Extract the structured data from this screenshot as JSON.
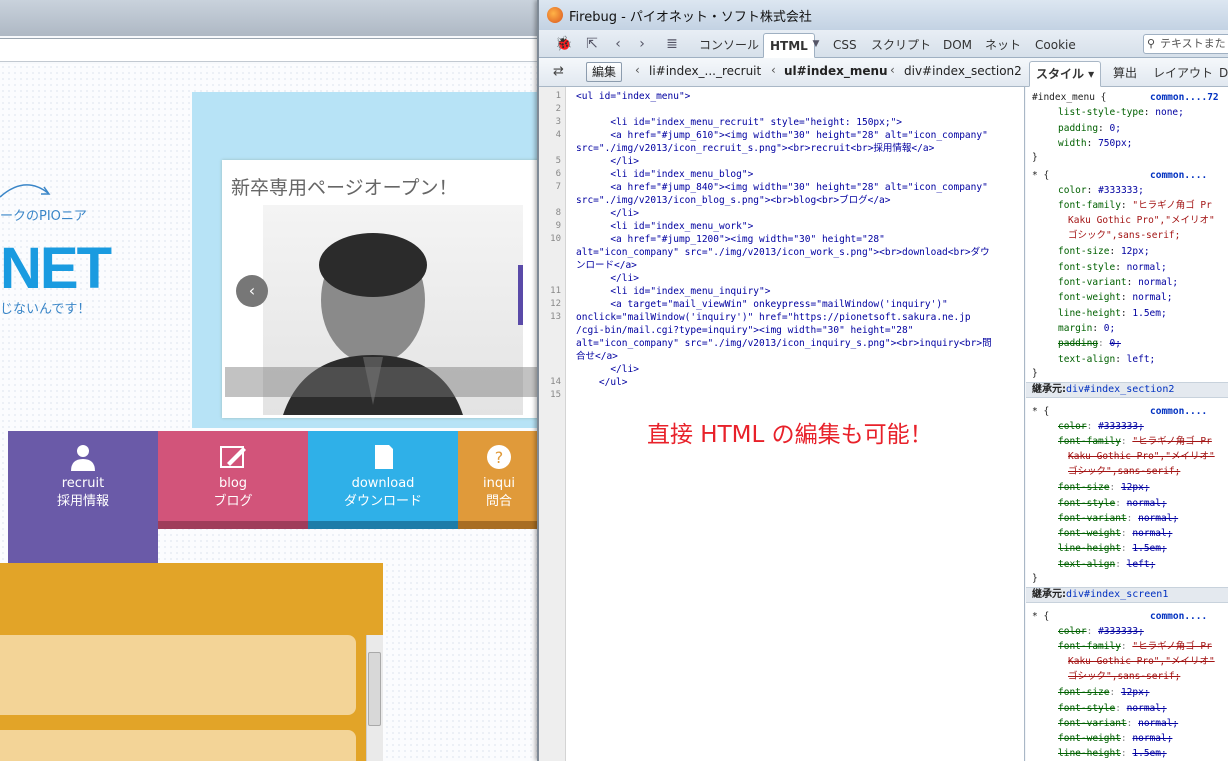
{
  "website": {
    "logo_sub": "ークのPIOニア",
    "logo_main": "NET",
    "logo_tag": "じないんです！",
    "slide_title": "新卒専用ページオープン！",
    "slide_prev_glyph": "‹",
    "nav": [
      {
        "en": "recruit",
        "ja": "採用情報",
        "icon": "people-icon"
      },
      {
        "en": "blog",
        "ja": "ブログ",
        "icon": "pen-icon"
      },
      {
        "en": "download",
        "ja": "ダウンロード",
        "icon": "document-icon"
      },
      {
        "en": "inqui",
        "ja": "問合",
        "icon": "question-icon"
      }
    ]
  },
  "firebug": {
    "title": "Firebug - パイオネット・ソフト株式会社",
    "tabs": [
      "コンソール",
      "HTML",
      "CSS",
      "スクリプト",
      "DOM",
      "ネット",
      "Cookie"
    ],
    "active_tab": "HTML",
    "search_placeholder": "テキストまた",
    "edit_button": "編集",
    "breadcrumbs": [
      "li#index_..._recruit",
      "ul#index_menu",
      "div#index_section2"
    ],
    "side_tabs": [
      "スタイル ▾",
      "算出",
      "レイアウト",
      "D"
    ],
    "annotation": "直接 HTML の編集も可能！",
    "code_lines": [
      "<ul id=\"index_menu\">",
      "",
      "      <li id=\"index_menu_recruit\" style=\"height: 150px;\">",
      "      <a href=\"#jump_610\"><img width=\"30\" height=\"28\" alt=\"icon_company\"",
      "src=\"./img/v2013/icon_recruit_s.png\"><br>recruit<br>採用情報</a>",
      "      </li>",
      "      <li id=\"index_menu_blog\">",
      "      <a href=\"#jump_840\"><img width=\"30\" height=\"28\" alt=\"icon_company\"",
      "src=\"./img/v2013/icon_blog_s.png\"><br>blog<br>ブログ</a>",
      "      </li>",
      "      <li id=\"index_menu_work\">",
      "      <a href=\"#jump_1200\"><img width=\"30\" height=\"28\"",
      "alt=\"icon_company\" src=\"./img/v2013/icon_work_s.png\"><br>download<br>ダウ",
      "ンロード</a>",
      "      </li>",
      "      <li id=\"index_menu_inquiry\">",
      "      <a target=\"mail_viewWin\" onkeypress=\"mailWindow('inquiry')\"",
      "onclick=\"mailWindow('inquiry')\" href=\"https://pionetsoft.sakura.ne.jp",
      "/cgi-bin/mail.cgi?type=inquiry\"><img width=\"30\" height=\"28\"",
      "alt=\"icon_company\" src=\"./img/v2013/icon_inquiry_s.png\"><br>inquiry<br>問",
      "合せ</a>",
      "      </li>",
      "    </ul>"
    ],
    "line_numbers": [
      "1",
      "2",
      "3",
      "4",
      "5",
      "6",
      "7",
      "8",
      "9",
      "10",
      "11",
      "12",
      "13",
      "14",
      "15"
    ],
    "css": {
      "rule1_selector": "#index_menu {",
      "rule1_source": "common....72",
      "rule1_props": [
        [
          "list-style-type",
          "none;"
        ],
        [
          "padding",
          "0;"
        ],
        [
          "width",
          "750px;"
        ]
      ],
      "close": "}",
      "star_selector": "* {",
      "star_source": "common....",
      "star_props": [
        [
          "color",
          "#333333;"
        ],
        [
          "font-family",
          "\"ヒラギノ角ゴ Pr"
        ],
        [
          "",
          "Kaku Gothic Pro\",\"メイリオ\""
        ],
        [
          "",
          "ゴシック\",sans-serif;"
        ],
        [
          "font-size",
          "12px;"
        ],
        [
          "font-style",
          "normal;"
        ],
        [
          "font-variant",
          "normal;"
        ],
        [
          "font-weight",
          "normal;"
        ],
        [
          "line-height",
          "1.5em;"
        ],
        [
          "margin",
          "0;"
        ],
        [
          "padding",
          "0;"
        ],
        [
          "text-align",
          "left;"
        ]
      ],
      "inherit_label": "継承元:",
      "inherit1_target": "div#index_section2",
      "inherit2_target": "div#index_screen1",
      "inh_props": [
        [
          "color",
          "#333333;"
        ],
        [
          "font-family",
          "\"ヒラギノ角ゴ Pr"
        ],
        [
          "",
          "Kaku Gothic Pro\",\"メイリオ\""
        ],
        [
          "",
          "ゴシック\",sans-serif;"
        ],
        [
          "font-size",
          "12px;"
        ],
        [
          "font-style",
          "normal;"
        ],
        [
          "font-variant",
          "normal;"
        ],
        [
          "font-weight",
          "normal;"
        ],
        [
          "line-height",
          "1.5em;"
        ],
        [
          "text-align",
          "left;"
        ]
      ]
    }
  },
  "colors": {
    "annotation": "#e8212a",
    "recruit": "#6a5aa8",
    "blog": "#d2547a",
    "download": "#2fb0e8",
    "inquiry": "#e09a3a"
  }
}
